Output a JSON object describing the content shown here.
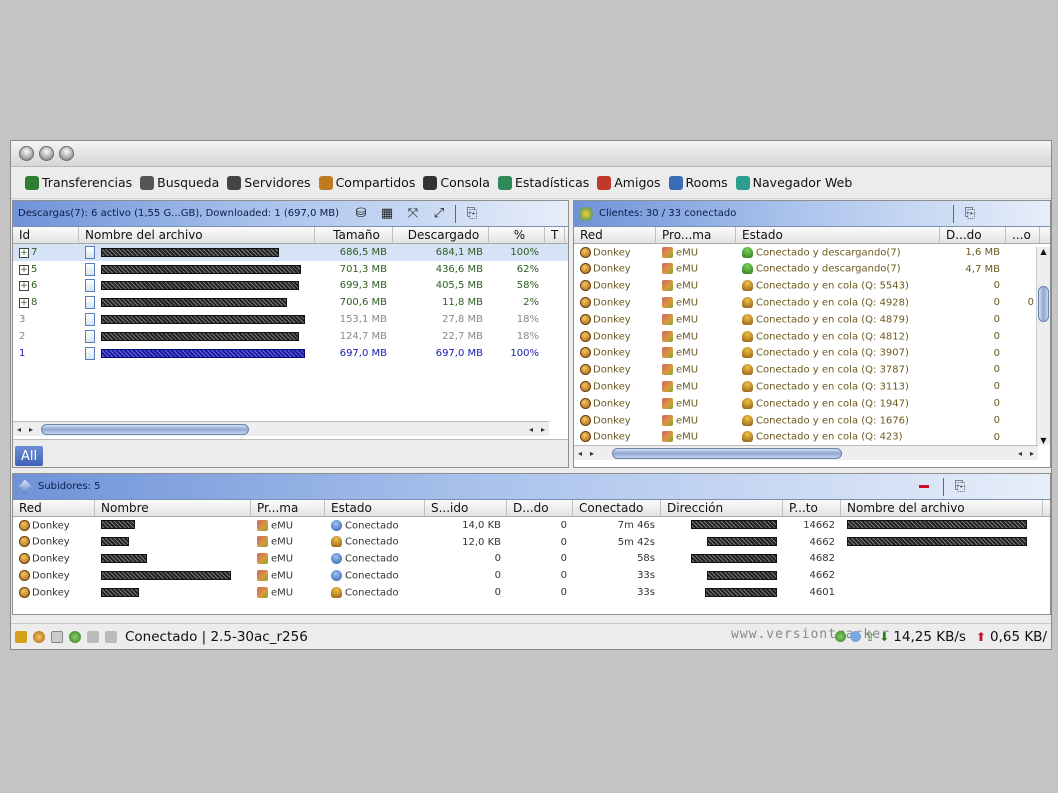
{
  "toolbar": {
    "items": [
      {
        "label": "Transferencias",
        "icon": "transfers-icon",
        "color": "#2e7d32"
      },
      {
        "label": "Busqueda",
        "icon": "search-icon",
        "color": "#555"
      },
      {
        "label": "Servidores",
        "icon": "servers-icon",
        "color": "#444"
      },
      {
        "label": "Compartidos",
        "icon": "shared-icon",
        "color": "#c07a20"
      },
      {
        "label": "Consola",
        "icon": "console-icon",
        "color": "#333"
      },
      {
        "label": "Estadísticas",
        "icon": "stats-icon",
        "color": "#2e8b57"
      },
      {
        "label": "Amigos",
        "icon": "friends-icon",
        "color": "#c0392b"
      },
      {
        "label": "Rooms",
        "icon": "rooms-icon",
        "color": "#3a6db5"
      },
      {
        "label": "Navegador Web",
        "icon": "browser-icon",
        "color": "#2a9d8f"
      }
    ]
  },
  "downloads": {
    "header": "Descargas(7): 6 activo (1,55 G...GB), Downloaded: 1 (697,0 MB)",
    "filter_label": "All",
    "columns": [
      "Id",
      "Nombre del archivo",
      "Tamaño",
      "Descargado",
      "%",
      "T"
    ],
    "rows": [
      {
        "id": "7",
        "size": "686,5 MB",
        "done": "684,1 MB",
        "pct": "100%",
        "color": "#2e5e20",
        "expand": true,
        "selected": true,
        "name_w": 178
      },
      {
        "id": "5",
        "size": "701,3 MB",
        "done": "436,6 MB",
        "pct": "62%",
        "color": "#2e5e20",
        "expand": true,
        "selected": false,
        "name_w": 200
      },
      {
        "id": "6",
        "size": "699,3 MB",
        "done": "405,5 MB",
        "pct": "58%",
        "color": "#2e5e20",
        "expand": true,
        "selected": false,
        "name_w": 198
      },
      {
        "id": "8",
        "size": "700,6 MB",
        "done": "11,8 MB",
        "pct": "2%",
        "color": "#2e5e20",
        "expand": true,
        "selected": false,
        "name_w": 186
      },
      {
        "id": "3",
        "size": "153,1 MB",
        "done": "27,8 MB",
        "pct": "18%",
        "color": "#888888",
        "expand": false,
        "selected": false,
        "name_w": 204
      },
      {
        "id": "2",
        "size": "124,7 MB",
        "done": "22,7 MB",
        "pct": "18%",
        "color": "#888888",
        "expand": false,
        "selected": false,
        "name_w": 198
      },
      {
        "id": "1",
        "size": "697,0 MB",
        "done": "697,0 MB",
        "pct": "100%",
        "color": "#1a1ab0",
        "expand": false,
        "selected": false,
        "name_w": 204
      }
    ]
  },
  "clients": {
    "header": "Clientes: 30 / 33 conectado",
    "columns": [
      "Red",
      "Pro...ma",
      "Estado",
      "D...do",
      "...o"
    ],
    "rows": [
      {
        "red": "Donkey",
        "prog": "eMU",
        "estado": "Conectado y descargando(7)",
        "dl": "1,6 MB",
        "kind": "dl"
      },
      {
        "red": "Donkey",
        "prog": "eMU",
        "estado": "Conectado y descargando(7)",
        "dl": "4,7 MB",
        "kind": "dl"
      },
      {
        "red": "Donkey",
        "prog": "eMU",
        "estado": "Conectado y en cola (Q: 5543)",
        "dl": "0",
        "kind": "q"
      },
      {
        "red": "Donkey",
        "prog": "eMU",
        "estado": "Conectado y en cola (Q: 4928)",
        "dl": "0",
        "kind": "q",
        "extra": "0"
      },
      {
        "red": "Donkey",
        "prog": "eMU",
        "estado": "Conectado y en cola (Q: 4879)",
        "dl": "0",
        "kind": "q"
      },
      {
        "red": "Donkey",
        "prog": "eMU",
        "estado": "Conectado y en cola (Q: 4812)",
        "dl": "0",
        "kind": "q"
      },
      {
        "red": "Donkey",
        "prog": "eMU",
        "estado": "Conectado y en cola (Q: 3907)",
        "dl": "0",
        "kind": "q"
      },
      {
        "red": "Donkey",
        "prog": "eMU",
        "estado": "Conectado y en cola (Q: 3787)",
        "dl": "0",
        "kind": "q"
      },
      {
        "red": "Donkey",
        "prog": "eMU",
        "estado": "Conectado y en cola (Q: 3113)",
        "dl": "0",
        "kind": "q"
      },
      {
        "red": "Donkey",
        "prog": "eMU",
        "estado": "Conectado y en cola (Q: 1947)",
        "dl": "0",
        "kind": "q"
      },
      {
        "red": "Donkey",
        "prog": "eMU",
        "estado": "Conectado y en cola (Q: 1676)",
        "dl": "0",
        "kind": "q"
      },
      {
        "red": "Donkey",
        "prog": "eMU",
        "estado": "Conectado y en cola (Q: 423)",
        "dl": "0",
        "kind": "q"
      }
    ]
  },
  "uploads": {
    "header": "Subidores: 5",
    "columns": [
      "Red",
      "Nombre",
      "Pr...ma",
      "Estado",
      "S...ido",
      "D...do",
      "Conectado",
      "Dirección",
      "P...to",
      "Nombre del archivo"
    ],
    "rows": [
      {
        "red": "Donkey",
        "prog": "eMU",
        "estado": "Conectado",
        "sent": "14,0 KB",
        "dl": "0",
        "time": "7m 46s",
        "port": "14662",
        "kind": "c",
        "name_w": 34,
        "dir_w": 86,
        "file_w": 180
      },
      {
        "red": "Donkey",
        "prog": "eMU",
        "estado": "Conectado",
        "sent": "12,0 KB",
        "dl": "0",
        "time": "5m 42s",
        "port": "4662",
        "kind": "q",
        "name_w": 28,
        "dir_w": 70,
        "file_w": 180
      },
      {
        "red": "Donkey",
        "prog": "eMU",
        "estado": "Conectado",
        "sent": "0",
        "dl": "0",
        "time": "58s",
        "port": "4682",
        "kind": "c",
        "name_w": 46,
        "dir_w": 86,
        "file_w": 0
      },
      {
        "red": "Donkey",
        "prog": "eMU",
        "estado": "Conectado",
        "sent": "0",
        "dl": "0",
        "time": "33s",
        "port": "4662",
        "kind": "c",
        "name_w": 130,
        "dir_w": 70,
        "file_w": 0
      },
      {
        "red": "Donkey",
        "prog": "eMU",
        "estado": "Conectado",
        "sent": "0",
        "dl": "0",
        "time": "33s",
        "port": "4601",
        "kind": "q",
        "name_w": 38,
        "dir_w": 72,
        "file_w": 0
      }
    ]
  },
  "status": {
    "text": "Conectado  | 2.5-30ac_r256",
    "watermark": "www.versiontracker.com",
    "down_rate": "14,25 KB/s",
    "up_rate": "0,65 KB/"
  }
}
